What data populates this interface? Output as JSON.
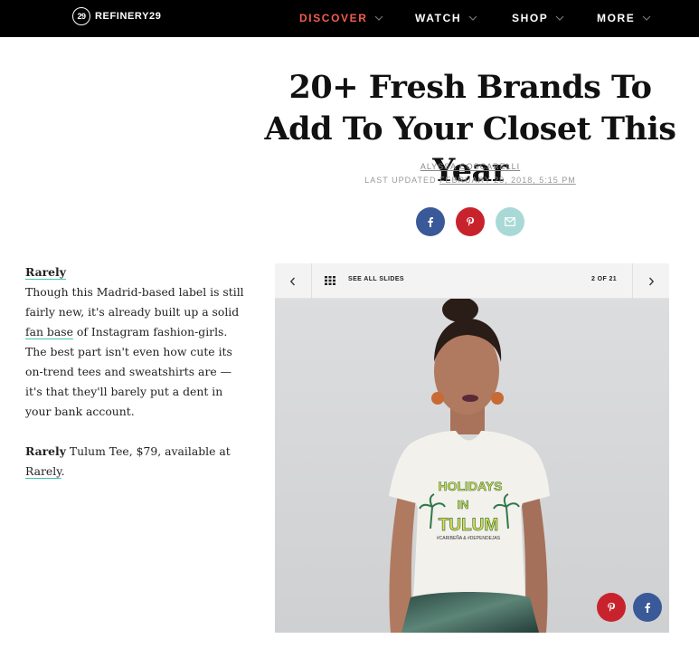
{
  "nav": {
    "logo_mark": "29",
    "logo_text": "REFINERY29",
    "items": [
      {
        "label": "DISCOVER",
        "active": true
      },
      {
        "label": "WATCH",
        "active": false
      },
      {
        "label": "SHOP",
        "active": false
      },
      {
        "label": "MORE",
        "active": false
      }
    ]
  },
  "article": {
    "title": "20+ Fresh Brands To Add To Your Closet This Year",
    "author": "ALYSSA COSCARELLI",
    "updated_label": "LAST UPDATED",
    "updated_date": "FEBRUARY 28, 2018, 5:15 PM",
    "share_icons": [
      "facebook-icon",
      "pinterest-icon",
      "mail-icon"
    ]
  },
  "slide": {
    "brand": "Rarely",
    "desc_1": "Though this Madrid-based label is still fairly new, it's already built up a solid",
    "fan_base_link": "fan base",
    "desc_2": "of Instagram fashion-girls. The best part isn't even how cute its on-trend tees and sweatshirts are — it's that they'll barely put a dent in your bank account.",
    "product_brand": "Rarely",
    "product_text": "Tulum Tee, $79, available at",
    "shop_link": "Rarely",
    "shop_link_suffix": "."
  },
  "slideshow": {
    "see_all_label": "SEE ALL SLIDES",
    "counter": "2 OF 21",
    "tee_line_1": "HOLIDAYS",
    "tee_line_2": "IN",
    "tee_line_3": "TULUM",
    "tee_small": "#CARIBEÑA & #DEPENDEJAS"
  },
  "colors": {
    "nav_bg": "#000000",
    "nav_active": "#f25b4e",
    "facebook": "#3a5998",
    "pinterest": "#c8232c",
    "mail": "#a9d9d6",
    "link_underline": "#3ec8a8"
  }
}
